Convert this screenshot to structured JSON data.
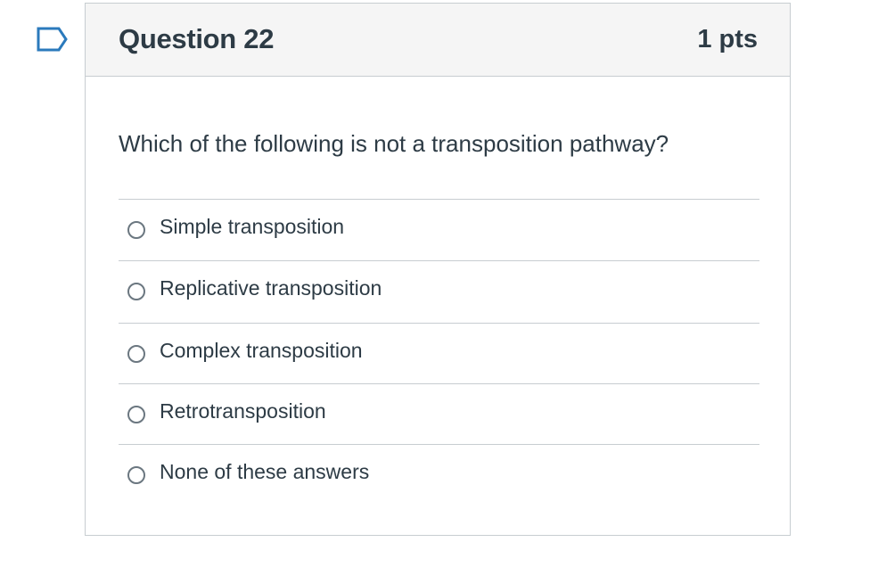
{
  "flag": {
    "icon": "bookmark-flag-icon",
    "color": "#2b7abc"
  },
  "question": {
    "title": "Question 22",
    "points": "1 pts",
    "text": "Which of the following is not a transposition pathway?",
    "selected_answer": null,
    "answers": [
      {
        "label": "Simple transposition"
      },
      {
        "label": "Replicative transposition"
      },
      {
        "label": "Complex transposition"
      },
      {
        "label": "Retrotransposition"
      },
      {
        "label": "None of these answers"
      }
    ]
  },
  "colors": {
    "header_bg": "#f5f5f5",
    "border": "#c7cdd1",
    "text": "#2d3b45",
    "radio_border": "#6b7780"
  }
}
